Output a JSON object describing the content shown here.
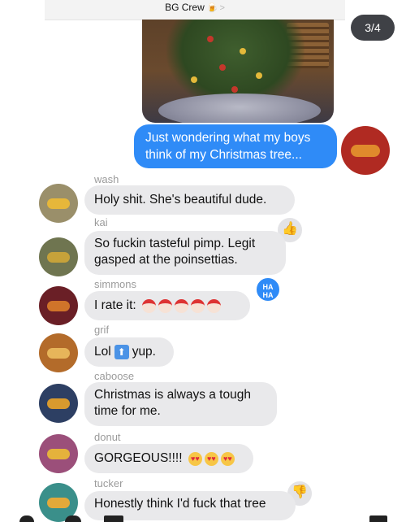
{
  "header": {
    "title": "BG Crew",
    "icon": "beer-emoji-icon",
    "chevron": ">"
  },
  "pager": "3/4",
  "photo": {
    "subject": "christmas-tree-photo"
  },
  "sent_message": "Just wondering what my boys think of my Christmas tree...",
  "messages": [
    {
      "sender": "wash",
      "text": "Holy shit. She's beautiful dude."
    },
    {
      "sender": "kai",
      "text": "So fuckin tasteful pimp. Legit gasped at the poinsettias.",
      "tapback": "thumbs-up"
    },
    {
      "sender": "simmons",
      "text": "I rate it:",
      "emoji": "santa x5",
      "tapback_text": "HA HA"
    },
    {
      "sender": "grif",
      "text_before": "Lol",
      "text_after": "yup.",
      "emoji": "up-arrow"
    },
    {
      "sender": "caboose",
      "text": "Christmas is always a tough time for me."
    },
    {
      "sender": "donut",
      "text": "GORGEOUS!!!!",
      "emoji": "heart-eyes x3"
    },
    {
      "sender": "tucker",
      "text": "Honestly think I'd fuck that tree",
      "tapback": "thumbs-down"
    }
  ],
  "colors": {
    "sent_bubble": "#2f8bf7",
    "received_bubble": "#e9e9eb",
    "sender_label": "#9b9b9b",
    "pager_bg": "#3f4146"
  }
}
